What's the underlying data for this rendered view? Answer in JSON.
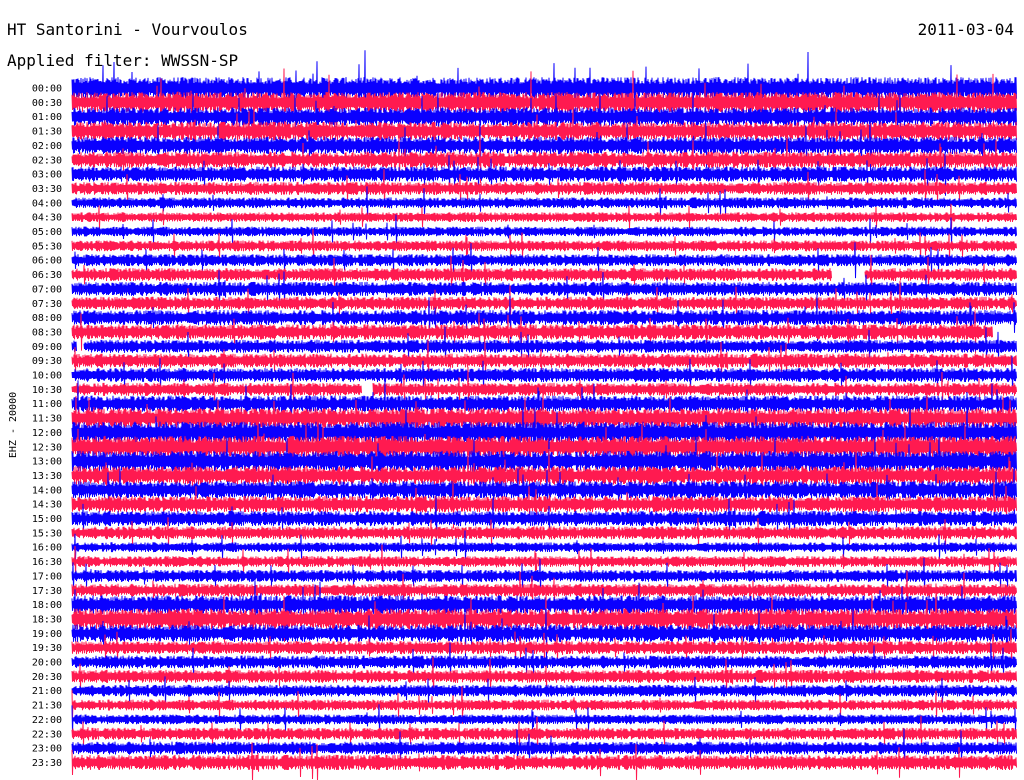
{
  "header": {
    "station": "HT Santorini - Vourvoulos",
    "date": "2011-03-04",
    "filter": "Applied filter: WWSSN-SP"
  },
  "chart_data": {
    "type": "line",
    "subtype": "helicorder",
    "title": "HT Santorini - Vourvoulos",
    "date": "2011-03-04",
    "filter": "WWSSN-SP",
    "ylabel": "EHZ - 20000",
    "xlabel": "",
    "time_labels": [
      "00:00",
      "00:30",
      "01:00",
      "01:30",
      "02:00",
      "02:30",
      "03:00",
      "03:30",
      "04:00",
      "04:30",
      "05:00",
      "05:30",
      "06:00",
      "06:30",
      "07:00",
      "07:30",
      "08:00",
      "08:30",
      "09:00",
      "09:30",
      "10:00",
      "10:30",
      "11:00",
      "11:30",
      "12:00",
      "12:30",
      "13:00",
      "13:30",
      "14:00",
      "14:30",
      "15:00",
      "15:30",
      "16:00",
      "16:30",
      "17:00",
      "17:30",
      "18:00",
      "18:30",
      "19:00",
      "19:30",
      "20:00",
      "20:30",
      "21:00",
      "21:30",
      "22:00",
      "22:30",
      "23:00",
      "23:30"
    ],
    "trace_colors": [
      "#0a00ff",
      "#ff1a50"
    ],
    "relative_amplitude": [
      1.0,
      0.95,
      0.85,
      0.85,
      0.8,
      0.75,
      0.7,
      0.6,
      0.5,
      0.45,
      0.45,
      0.5,
      0.55,
      0.6,
      0.65,
      0.6,
      0.7,
      0.7,
      0.6,
      0.65,
      0.65,
      0.6,
      0.75,
      0.9,
      1.0,
      1.0,
      0.95,
      0.85,
      0.8,
      0.75,
      0.7,
      0.6,
      0.45,
      0.5,
      0.55,
      0.6,
      0.85,
      0.95,
      0.8,
      0.6,
      0.6,
      0.6,
      0.55,
      0.5,
      0.45,
      0.55,
      0.6,
      0.7
    ],
    "gaps": [
      {
        "row": "06:30",
        "from_fraction": 0.805,
        "to_fraction": 0.84
      },
      {
        "row": "08:30",
        "from_fraction": 0.975,
        "to_fraction": 1.0
      },
      {
        "row": "09:00",
        "from_fraction": 0.005,
        "to_fraction": 0.012
      },
      {
        "row": "10:30",
        "from_fraction": 0.307,
        "to_fraction": 0.318
      }
    ],
    "grid": false,
    "legend": "none"
  }
}
